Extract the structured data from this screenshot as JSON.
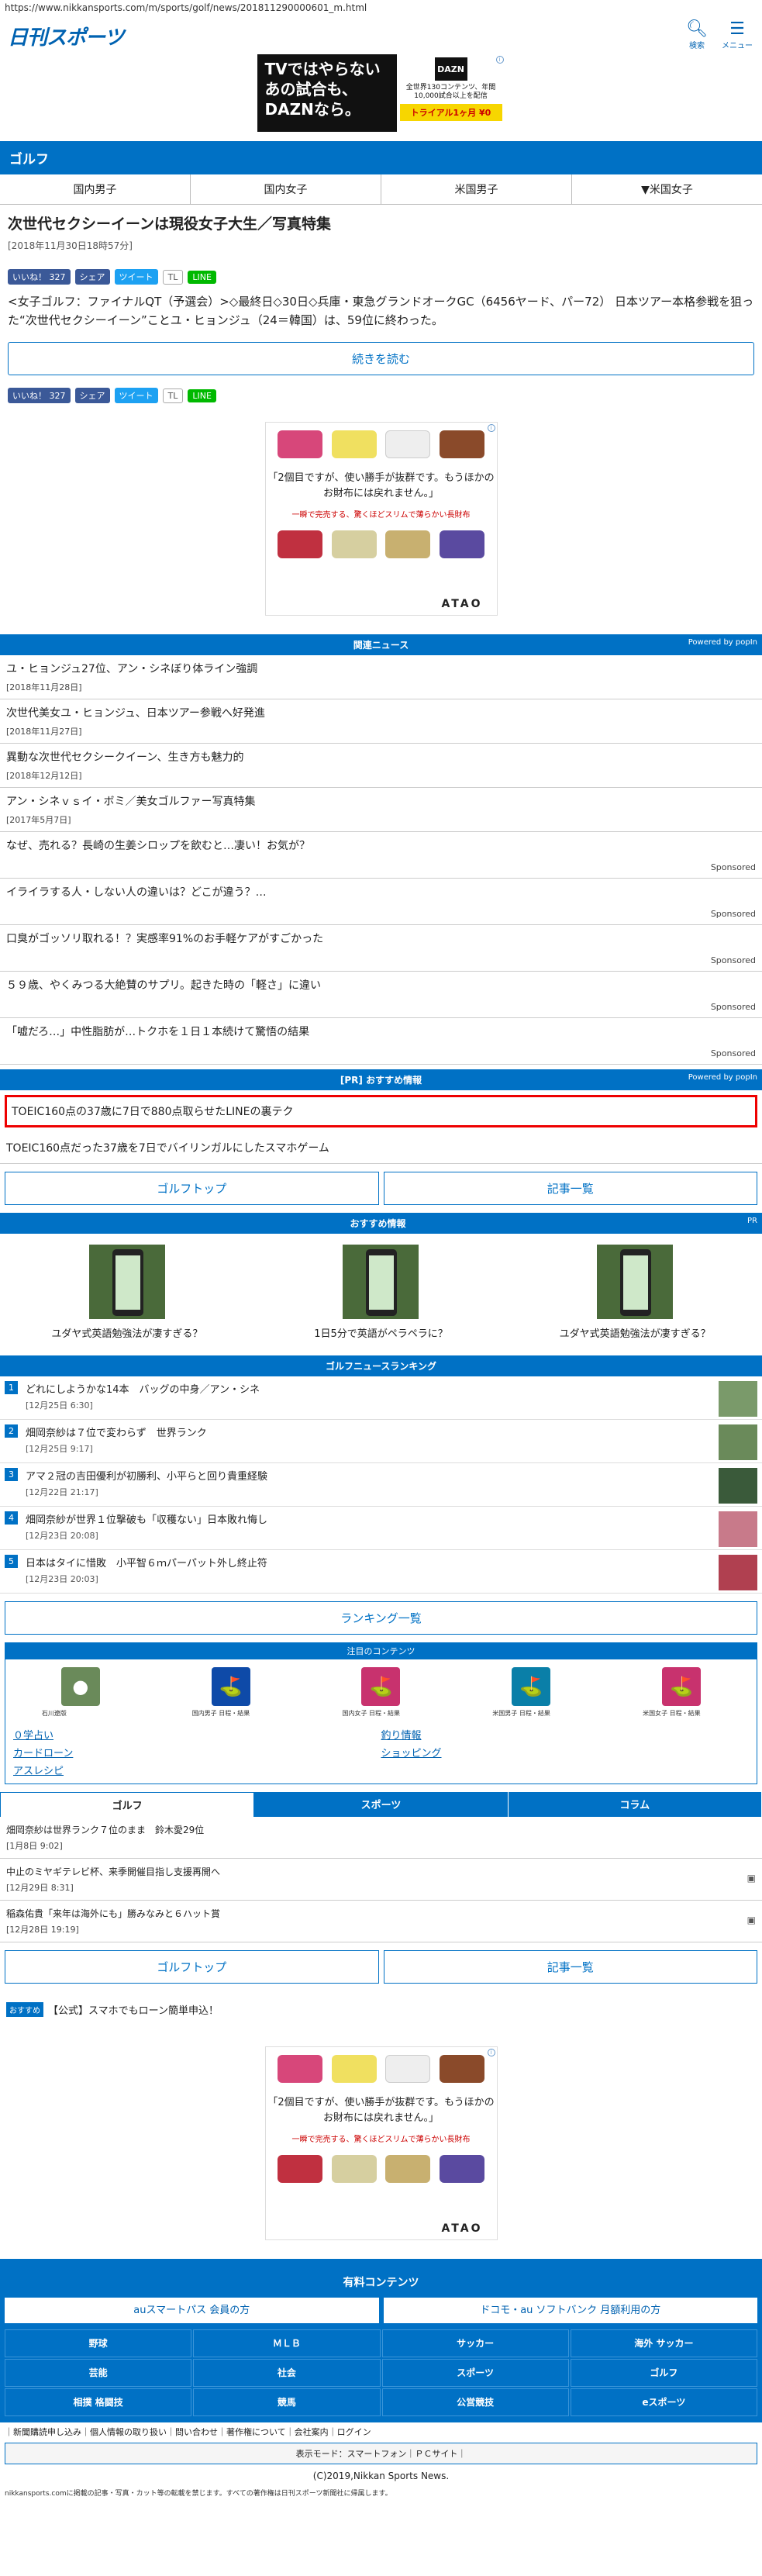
{
  "browser": {
    "url": "https://www.nikkansports.com/m/sports/golf/news/201811290000601_m.html"
  },
  "header": {
    "logo": "日刊スポーツ",
    "search_label": "検索",
    "menu_label": "メニュー"
  },
  "top_ad": {
    "headline": "TVではやらない あの試合も、DAZNなら。",
    "brand": "DAZN",
    "sub": "全世界130コンテンツ、年間10,000試合以上を配信",
    "cta": "トライアル1ヶ月 ¥0"
  },
  "section": "ゴルフ",
  "tabs": [
    "国内男子",
    "国内女子",
    "米国男子",
    "▼米国女子"
  ],
  "article": {
    "title": "次世代セクシーイーンは現役女子大生／写真特集",
    "date": "[2018年11月30日18時57分]",
    "lead": "<女子ゴルフ：ファイナルQT（予選会）>◇最終日◇30日◇兵庫・東急グランドオークGC（6456ヤード、パー72） 日本ツアー本格参戦を狙った“次世代セクシーイーン”ことユ・ヒョンジュ（24＝韓国）は、59位に終わった。",
    "continue": "続きを読む"
  },
  "share": {
    "like": "いいね！ 327",
    "share": "シェア",
    "tweet": "ツイート",
    "tl": "TL",
    "line": "LINE"
  },
  "wallet_ad": {
    "text": "「2個目ですが、使い勝手が抜群です。もうほかのお財布には戻れません。」",
    "sub": "一瞬で完売する、驚くほどスリムで薄らかい長財布",
    "brand": "ATAO"
  },
  "related": {
    "header": "関連ニュース",
    "powered": "Powered by popIn",
    "items": [
      {
        "title": "ユ・ヒョンジュ27位、アン・シネぼり体ライン強調",
        "date": "[2018年11月28日]"
      },
      {
        "title": "次世代美女ユ・ヒョンジュ、日本ツアー参戦へ好発進",
        "date": "[2018年11月27日]"
      },
      {
        "title": "異動な次世代セクシークイーン、生き方も魅力的",
        "date": "[2018年12月12日]"
      },
      {
        "title": "アン・シネｖｓイ・ボミ／美女ゴルファー写真特集",
        "date": "[2017年5月7日]"
      },
      {
        "title": "なぜ、売れる？長崎の生姜シロップを飲むと…凄い！お気が？",
        "sponsored": "Sponsored"
      },
      {
        "title": "イライラする人・しない人の違いは？どこが違う？…",
        "sponsored": "Sponsored"
      },
      {
        "title": "口臭がゴッソリ取れる！？実感率91%のお手軽ケアがすごかった",
        "sponsored": "Sponsored"
      },
      {
        "title": "５９歳、やくみつる大絶賛のサプリ。起きた時の「軽さ」に違い",
        "sponsored": "Sponsored"
      },
      {
        "title": "「嘘だろ…」中性脂肪が…トクホを１日１本続けて驚悟の結果",
        "sponsored": "Sponsored"
      }
    ]
  },
  "pr": {
    "header": "[PR] おすすめ情報",
    "powered": "Powered by popIn",
    "items": [
      "TOEIC160点の37歳に7日で880点取らせたLINEの裏テク",
      "TOEIC160点だった37歳を7日でバイリンガルにしたスマホゲーム"
    ]
  },
  "buttons": {
    "golf_top": "ゴルフトップ",
    "article_list": "記事一覧"
  },
  "recommend": {
    "header": "おすすめ情報",
    "pr": "PR",
    "items": [
      "ユダヤ式英語勉強法が凄すぎる？",
      "1日5分で英語がペラペラに？",
      "ユダヤ式英語勉強法が凄すぎる？"
    ]
  },
  "ranking": {
    "header": "ゴルフニュースランキング",
    "items": [
      {
        "n": "1",
        "title": "どれにしようかな14本　バッグの中身／アン・シネ",
        "date": "[12月25日 6:30]"
      },
      {
        "n": "2",
        "title": "畑岡奈紗は７位で変わらず　世界ランク",
        "date": "[12月25日 9:17]"
      },
      {
        "n": "3",
        "title": "アマ２冠の吉田優利が初勝利、小平らと回り貴重経験",
        "date": "[12月22日 21:17]"
      },
      {
        "n": "4",
        "title": "畑岡奈紗が世界１位撃破も「収穫ない」日本敗れ悔し",
        "date": "[12月23日 20:08]"
      },
      {
        "n": "5",
        "title": "日本はタイに惜敗　小平智６ｍパーパット外し終止符",
        "date": "[12月23日 20:03]"
      }
    ],
    "all": "ランキング一覧"
  },
  "contents": {
    "header": "注目のコンテンツ",
    "icons": [
      "石川遼版",
      "国内男子 日程・結果",
      "国内女子 日程・結果",
      "米国男子 日程・結果",
      "米国女子 日程・結果"
    ],
    "links": [
      "０学占い",
      "釣り情報",
      "カードローン",
      "ショッピング",
      "アスレシピ"
    ]
  },
  "lower_tabs": [
    "ゴルフ",
    "スポーツ",
    "コラム"
  ],
  "golf_news": [
    {
      "title": "畑岡奈紗は世界ランク７位のまま　鈴木愛29位",
      "date": "[1月8日 9:02]"
    },
    {
      "title": "中止のミヤギテレビ杯、来季開催目指し支援再開へ",
      "date": "[12月29日 8:31]"
    },
    {
      "title": "稲森佑貴「来年は海外にも」勝みなみと６ハット賞",
      "date": "[12月28日 19:19]"
    }
  ],
  "osusume": {
    "tag": "おすすめ",
    "text": "【公式】スマホでもローン簡単申込！"
  },
  "paid": {
    "header": "有料コンテンツ",
    "au": "auスマートパス 会員の方",
    "docomo": "ドコモ・au ソフトバンク 月額利用の方"
  },
  "categories": [
    "野球",
    "ＭＬＢ",
    "サッカー",
    "海外 サッカー",
    "芸能",
    "社会",
    "スポーツ",
    "ゴルフ",
    "相撲 格闘技",
    "競馬",
    "公営競技",
    "eスポーツ"
  ],
  "footer": {
    "links": "｜新聞購読申し込み｜個人情報の取り扱い｜問い合わせ｜著作権について｜会社案内｜ログイン",
    "display_mode": "表示モード：スマートフォン｜ＰＣサイト｜",
    "copyright": "(C)2019,Nikkan Sports News.",
    "disclaimer": "nikkansports.comに掲載の記事・写真・カット等の転載を禁じます。すべての著作権は日刊スポーツ新聞社に帰属します。"
  },
  "colors": {
    "brand_blue": "#0071c5",
    "highlight": "#e00000"
  }
}
